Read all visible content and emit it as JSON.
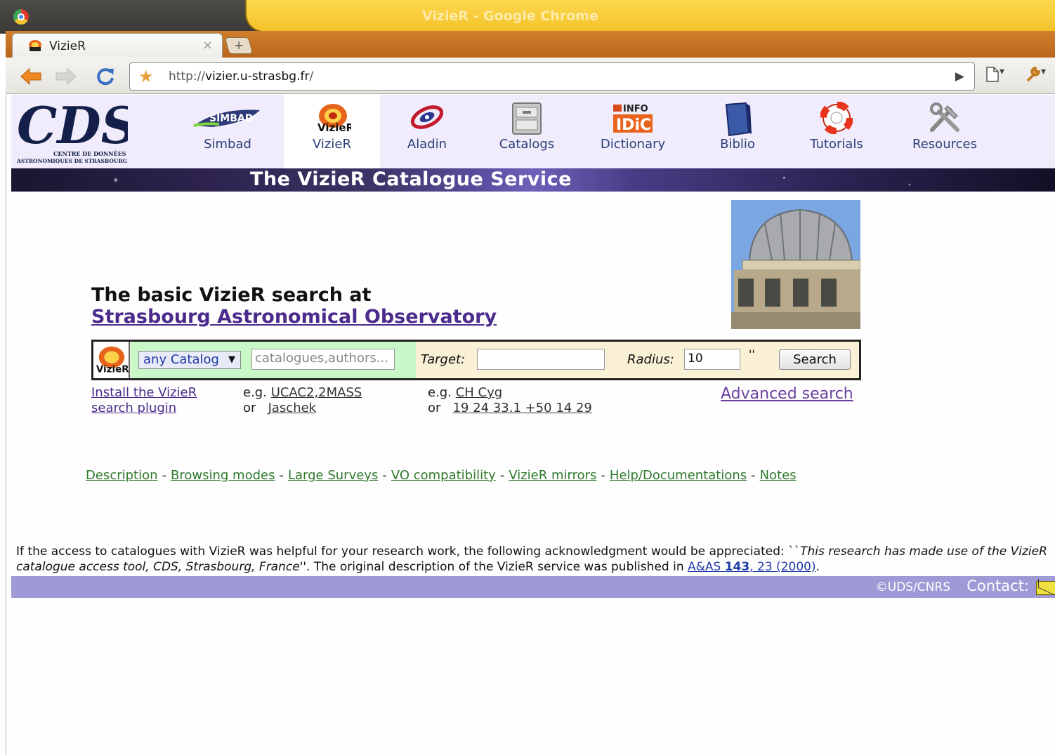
{
  "window": {
    "title": "VizieR - Google Chrome"
  },
  "tab": {
    "title": "VizieR",
    "close_glyph": "×",
    "new_tab_glyph": "+"
  },
  "toolbar": {
    "url_prefix": "http://",
    "url_host": "vizier.u-strasbg.fr",
    "url_suffix": "/",
    "go_glyph": "▶",
    "page_menu_glyph": "▾",
    "wrench_glyph": "▾"
  },
  "header": {
    "logo_text": "CDS",
    "logo_subtitle_1": "CENTRE DE DONNÉES",
    "logo_subtitle_2": "ASTRONOMIQUES DE STRASBOURG",
    "nav": [
      {
        "label": "Simbad",
        "icon": "simbad-icon",
        "icon_text": "SIMBAD"
      },
      {
        "label": "VizieR",
        "icon": "vizier-icon",
        "icon_text": "VizieR"
      },
      {
        "label": "Aladin",
        "icon": "aladin-icon"
      },
      {
        "label": "Catalogs",
        "icon": "catalogs-icon"
      },
      {
        "label": "Dictionary",
        "icon": "dictionary-icon",
        "icon_text_1": "INFO",
        "icon_text_2": "IDiC"
      },
      {
        "label": "Biblio",
        "icon": "biblio-icon"
      },
      {
        "label": "Tutorials",
        "icon": "tutorials-icon"
      },
      {
        "label": "Resources",
        "icon": "resources-icon"
      }
    ]
  },
  "banner": {
    "title": "The VizieR Catalogue Service"
  },
  "main": {
    "headline": "The basic VizieR search at",
    "headline_link": "Strasbourg Astronomical Observatory"
  },
  "form": {
    "catalog_select": "any Catalog",
    "catalog_placeholder": "catalogues,authors...",
    "target_label": "Target:",
    "target_value": "",
    "radius_label": "Radius:",
    "radius_value": "10",
    "radius_unit": "''",
    "search_label": "Search"
  },
  "hints": {
    "plugin_line1": "Install the VizieR",
    "plugin_line2": "search plugin",
    "eg": "e.g.",
    "or": "or",
    "cat_example_1": "UCAC2,2MASS",
    "cat_example_2": "Jaschek",
    "target_example_1": "CH Cyg",
    "target_example_2": "19 24 33.1 +50 14 29",
    "advanced": "Advanced search"
  },
  "footer_nav": [
    "Description",
    "Browsing modes",
    "Large Surveys",
    "VO compatibility",
    "VizieR mirrors",
    "Help/Documentations",
    "Notes"
  ],
  "footer_sep": "-",
  "acknowledgment": {
    "text1": "If the access to catalogues with VizieR was helpful for your research work, the following acknowledgment would be appreciated: ``",
    "quote": "This research has made use of the VizieR catalogue access tool, CDS, Strasbourg, France",
    "text2": "''. The original description of the VizieR service was published in ",
    "ref_journal": "A&AS ",
    "ref_volume": "143",
    "ref_rest": ", 23 (2000)",
    "end": "."
  },
  "bottom_bar": {
    "copyright": "©UDS/CNRS",
    "contact": "Contact:"
  }
}
